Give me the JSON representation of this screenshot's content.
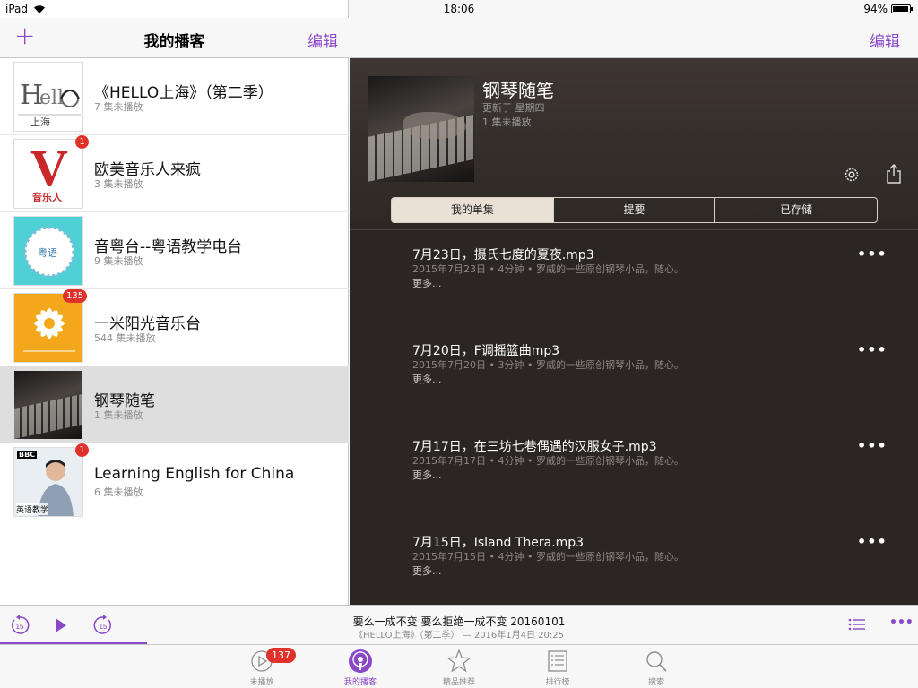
{
  "status_bar": {
    "device": "iPad",
    "time": "18:06",
    "battery": "94%"
  },
  "left_nav": {
    "add_symbol": "+",
    "title": "我的播客",
    "edit_label": "编辑"
  },
  "podcasts": [
    {
      "name": "《HELLO上海》（第二季）",
      "sub": "7 集未播放",
      "badge": ""
    },
    {
      "name": "欧美音乐人来疯",
      "sub": "3 集未播放",
      "badge": "1"
    },
    {
      "name": "音粤台--粤语教学电台",
      "sub": "9 集未播放",
      "badge": ""
    },
    {
      "name": "一米阳光音乐台",
      "sub": "544 集未播放",
      "badge": "135"
    },
    {
      "name": "钢琴随笔",
      "sub": "1 集未播放",
      "badge": ""
    },
    {
      "name": "Learning English for China",
      "sub": "6 集未播放",
      "badge": "1"
    }
  ],
  "art_text": {
    "hello": "上海",
    "v_letter": "V",
    "v_caption": "音乐人",
    "yue": "粤语",
    "bbc": "BBC",
    "bbc_cn": "英语教学"
  },
  "right_nav": {
    "edit_label": "编辑"
  },
  "detail": {
    "title": "钢琴随笔",
    "updated": "更新于 星期四",
    "unplayed": "1 集未播放",
    "segments": [
      "我的单集",
      "提要",
      "已存储"
    ],
    "active_segment": 0
  },
  "episodes": [
    {
      "title": "7月23日，摄氏七度的夏夜.mp3",
      "meta": "2015年7月23日 • 4分钟 • 罗威的一些原创钢琴小品，随心。",
      "more": "更多..."
    },
    {
      "title": "7月20日，F调摇篮曲mp3",
      "meta": "2015年7月20日 • 3分钟 • 罗威的一些原创钢琴小品，随心。",
      "more": "更多..."
    },
    {
      "title": "7月17日，在三坊七巷偶遇的汉服女子.mp3",
      "meta": "2015年7月17日 • 4分钟 • 罗威的一些原创钢琴小品，随心。",
      "more": "更多..."
    },
    {
      "title": "7月15日，Island Thera.mp3",
      "meta": "2015年7月15日 • 4分钟 • 罗威的一些原创钢琴小品，随心。",
      "more": "更多..."
    }
  ],
  "player": {
    "now_playing_title": "要么一成不变 要么拒绝一成不变 20160101",
    "now_playing_sub": "《HELLO上海》（第二季） — 2016年1月4日 20:25",
    "skip_seconds": "15",
    "progress_fraction": 0.16
  },
  "tabs": [
    {
      "label": "未播放",
      "icon": "play-circle-icon",
      "badge": "137"
    },
    {
      "label": "我的播客",
      "icon": "podcast-icon",
      "badge": ""
    },
    {
      "label": "精品推荐",
      "icon": "star-icon",
      "badge": ""
    },
    {
      "label": "排行榜",
      "icon": "list-icon",
      "badge": ""
    },
    {
      "label": "搜索",
      "icon": "search-icon",
      "badge": ""
    }
  ],
  "active_tab": 1,
  "colors": {
    "accent": "#8a47c8",
    "badge": "#e0322a",
    "detail_bg": "#2b2623"
  }
}
